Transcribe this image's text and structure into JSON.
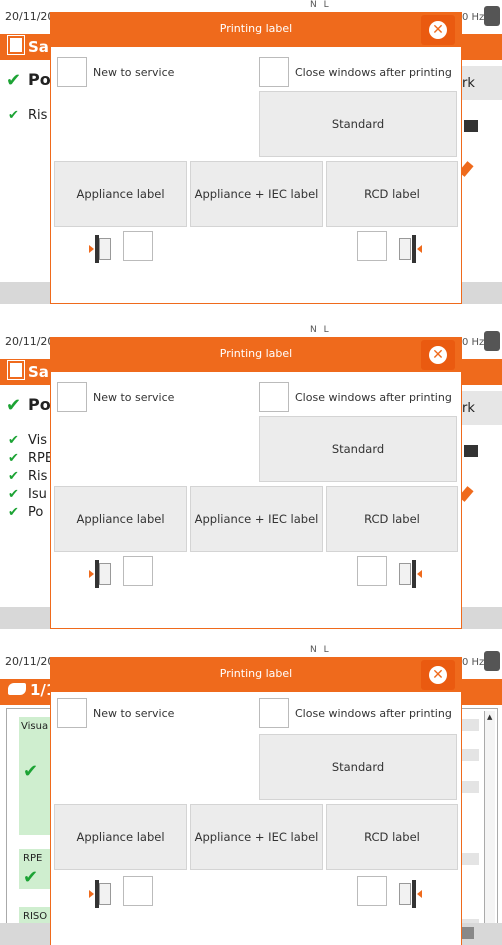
{
  "screens": [
    {
      "date": "20/11/20",
      "phase_label": "N L",
      "freq": "0 Hz",
      "bg_title": "Sa",
      "bg_rows": [
        "Po",
        "Ris"
      ],
      "bg_right": [
        "rk"
      ]
    },
    {
      "date": "20/11/20",
      "phase_label": "N L",
      "freq": "0 Hz",
      "bg_title": "Sa",
      "bg_rows": [
        "Po",
        "Vis",
        "RPE",
        "Ris",
        "Isu",
        "Po"
      ],
      "bg_right": [
        "rk"
      ]
    },
    {
      "date": "20/11/20",
      "phase_label": "N L",
      "freq": "0 Hz",
      "bg_title": "1/1",
      "bg_rows": [
        "Visua",
        "RPE",
        "RISO"
      ],
      "bg_right": []
    }
  ],
  "dialog": {
    "title": "Printing label",
    "new_to_service": "New to service",
    "close_after_printing": "Close windows after printing",
    "standard": "Standard",
    "appliance_label": "Appliance label",
    "appliance_iec_label": "Appliance + IEC label",
    "rcd_label": "RCD label",
    "close_icon": "close-icon",
    "colors": {
      "accent": "#ef6a1c",
      "button": "#ececec"
    }
  }
}
